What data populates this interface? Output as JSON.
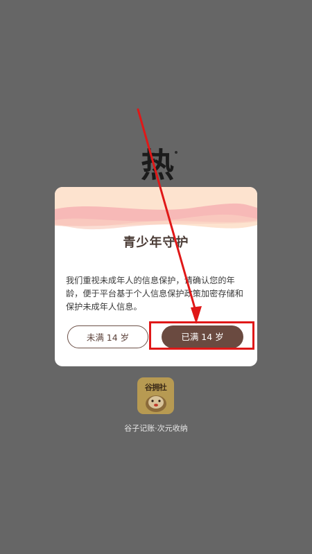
{
  "background": {
    "glyph": "热"
  },
  "dialog": {
    "title": "青少年守护",
    "body": "我们重视未成年人的信息保护，请确认您的年龄，便于平台基于个人信息保护政策加密存储和保护未成年人信息。",
    "under_14_label": "未满 14 岁",
    "over_14_label": "已满 14 岁"
  },
  "app": {
    "icon_text": "谷拥社",
    "name": "谷子记账·次元收纳"
  },
  "colors": {
    "backdrop": "#666666",
    "primary_button": "#6a4a40",
    "annotation_red": "#e01818",
    "header_band": "#fbd9c2"
  }
}
